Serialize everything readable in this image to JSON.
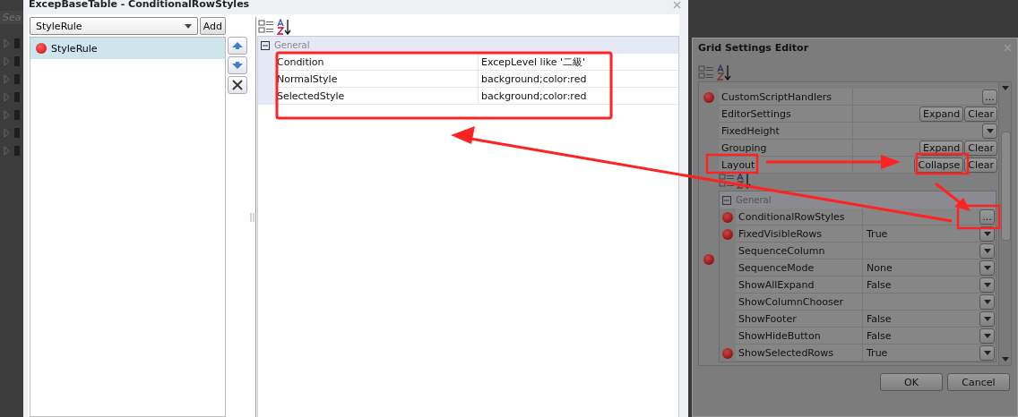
{
  "background_panel": {
    "search_placeholder": "Sea"
  },
  "rule_dialog": {
    "title": "ExcepBaseTable - ConditionalRowStyles",
    "rule_select": {
      "value": "StyleRule"
    },
    "add_button": "Add",
    "rules": [
      {
        "label": "StyleRule",
        "selected": true,
        "modified": true
      }
    ],
    "property_grid": {
      "category": {
        "label": "General",
        "expanded": true
      },
      "properties": [
        {
          "name": "Condition",
          "value": "ExcepLevel like '二級'"
        },
        {
          "name": "NormalStyle",
          "value": "background;color:red"
        },
        {
          "name": "SelectedStyle",
          "value": "background;color:red"
        }
      ]
    }
  },
  "grid_settings": {
    "title": "Grid Settings Editor",
    "properties": [
      {
        "name": "CustomScriptHandlers",
        "modified": true,
        "kind": "dialog",
        "button": "..."
      },
      {
        "name": "EditorSettings",
        "modified": false,
        "kind": "expandable",
        "expanded": false,
        "buttons": [
          "Expand",
          "Clear"
        ]
      },
      {
        "name": "FixedHeight",
        "modified": false,
        "kind": "dropdown"
      },
      {
        "name": "Grouping",
        "modified": false,
        "kind": "expandable",
        "expanded": false,
        "buttons": [
          "Expand",
          "Clear"
        ]
      },
      {
        "name": "Layout",
        "modified": true,
        "kind": "expandable",
        "expanded": true,
        "buttons": [
          "Collapse",
          "Clear"
        ],
        "category": {
          "label": "General",
          "expanded": true
        },
        "children": [
          {
            "name": "ConditionalRowStyles",
            "modified": true,
            "kind": "dialog",
            "button": "..."
          },
          {
            "name": "FixedVisibleRows",
            "modified": true,
            "kind": "dropdown",
            "value": "True"
          },
          {
            "name": "SequenceColumn",
            "modified": false,
            "kind": "dropdown"
          },
          {
            "name": "SequenceMode",
            "modified": false,
            "kind": "dropdown",
            "value": "None"
          },
          {
            "name": "ShowAllExpand",
            "modified": false,
            "kind": "dropdown",
            "value": "False"
          },
          {
            "name": "ShowColumnChooser",
            "modified": false,
            "kind": "dropdown"
          },
          {
            "name": "ShowFooter",
            "modified": false,
            "kind": "dropdown",
            "value": "False"
          },
          {
            "name": "ShowHideButton",
            "modified": false,
            "kind": "dropdown",
            "value": "False"
          },
          {
            "name": "ShowSelectedRows",
            "modified": true,
            "kind": "dropdown",
            "value": "True"
          }
        ]
      }
    ],
    "buttons": [
      "OK",
      "Cancel"
    ]
  }
}
